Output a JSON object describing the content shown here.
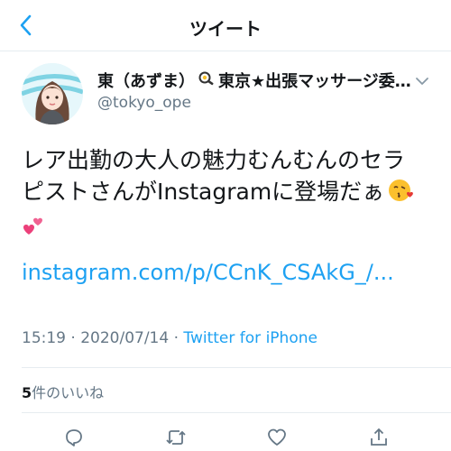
{
  "header": {
    "title": "ツイート",
    "back_icon": "chevron-left-icon"
  },
  "tweet": {
    "display_name": "東（あずま）",
    "display_name_rest": "東京★出張マッサージ委…",
    "handle": "@tokyo_ope",
    "text_line1": "レア出勤の大人の魅力むんむんのセラ",
    "text_line2": "ピストさんがInstagramに登場だぁ",
    "emoji_kiss": "kissing-face-heart-emoji",
    "emoji_hearts": "two-hearts-emoji",
    "link": "instagram.com/p/CCnK_CSAkG_/...",
    "time": "15:19 · 2020/07/14 · ",
    "source": "Twitter for iPhone",
    "likes_count": "5",
    "likes_label": "件のいいね"
  },
  "actions": [
    "reply-icon",
    "retweet-icon",
    "like-icon",
    "share-icon"
  ],
  "colors": {
    "accent": "#1da1f2",
    "muted": "#657786",
    "divider": "#e6ecf0"
  }
}
